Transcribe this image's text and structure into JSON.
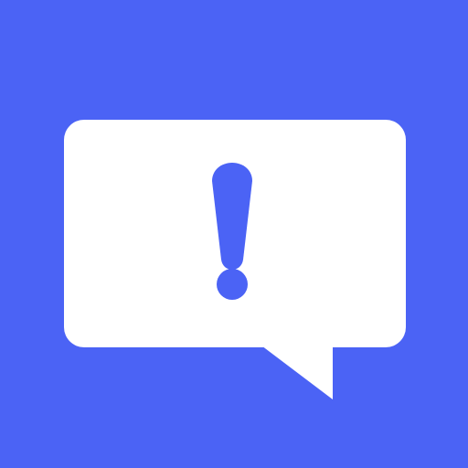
{
  "icon": {
    "name": "alert-message-icon",
    "colors": {
      "background": "#4B63F5",
      "bubble": "#FFFFFF",
      "exclamation": "#4B63F5"
    }
  }
}
